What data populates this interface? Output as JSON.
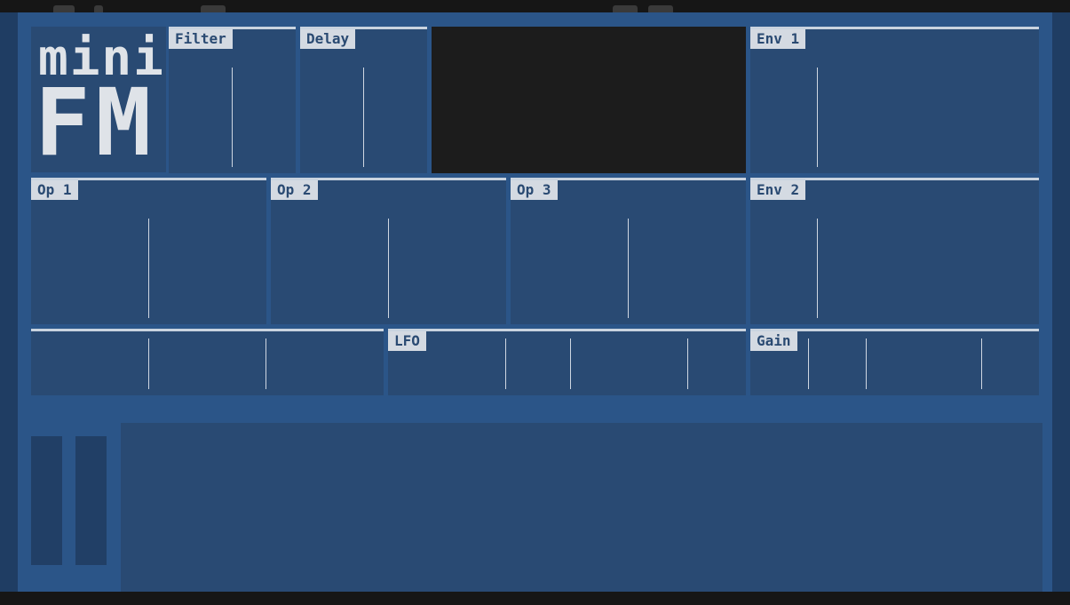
{
  "logo": {
    "line1": "mini",
    "line2": "FM"
  },
  "panels": {
    "filter": {
      "label": "Filter"
    },
    "delay": {
      "label": "Delay"
    },
    "env1": {
      "label": "Env 1"
    },
    "op1": {
      "label": "Op 1"
    },
    "op2": {
      "label": "Op 2"
    },
    "op3": {
      "label": "Op 3"
    },
    "env2": {
      "label": "Env 2"
    },
    "lfo": {
      "label": "LFO"
    },
    "gain": {
      "label": "Gain"
    }
  },
  "colors": {
    "panel": "#294a73",
    "frame": "#2b5588",
    "label_bg": "#d4dae2",
    "label_text": "#2a4a72",
    "display": "#1c1c1c"
  }
}
